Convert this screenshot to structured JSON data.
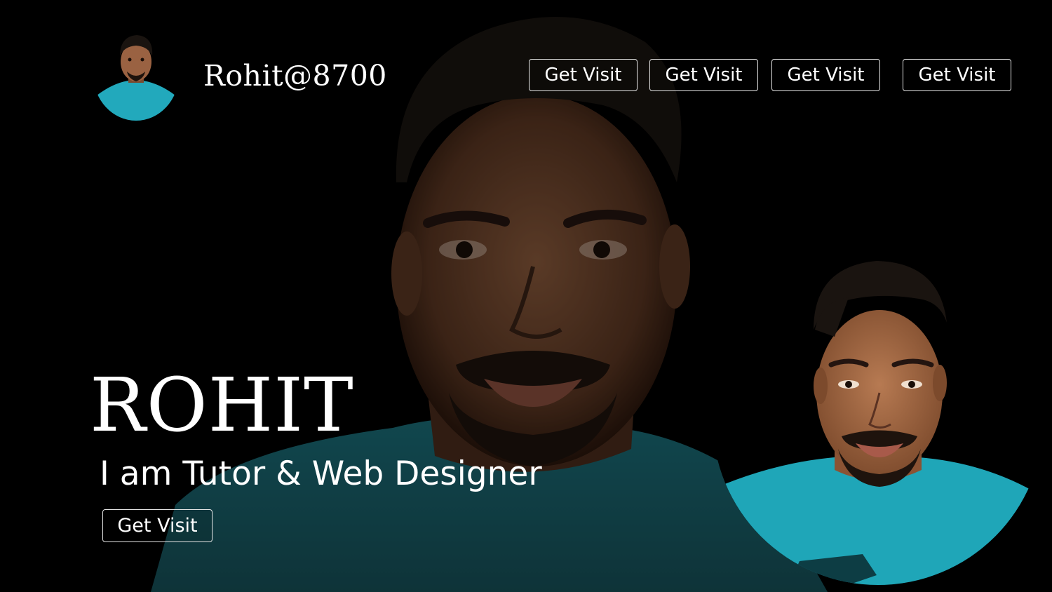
{
  "header": {
    "site_title": "Rohit@8700"
  },
  "nav": {
    "items": [
      {
        "label": "Get Visit"
      },
      {
        "label": "Get Visit"
      },
      {
        "label": "Get Visit"
      },
      {
        "label": "Get Visit"
      }
    ]
  },
  "hero": {
    "name": "ROHIT",
    "tagline": "I am Tutor & Web Designer",
    "cta_label": "Get Visit"
  },
  "colors": {
    "background": "#000000",
    "shirt": "#1fa6b8",
    "text": "#ffffff"
  }
}
